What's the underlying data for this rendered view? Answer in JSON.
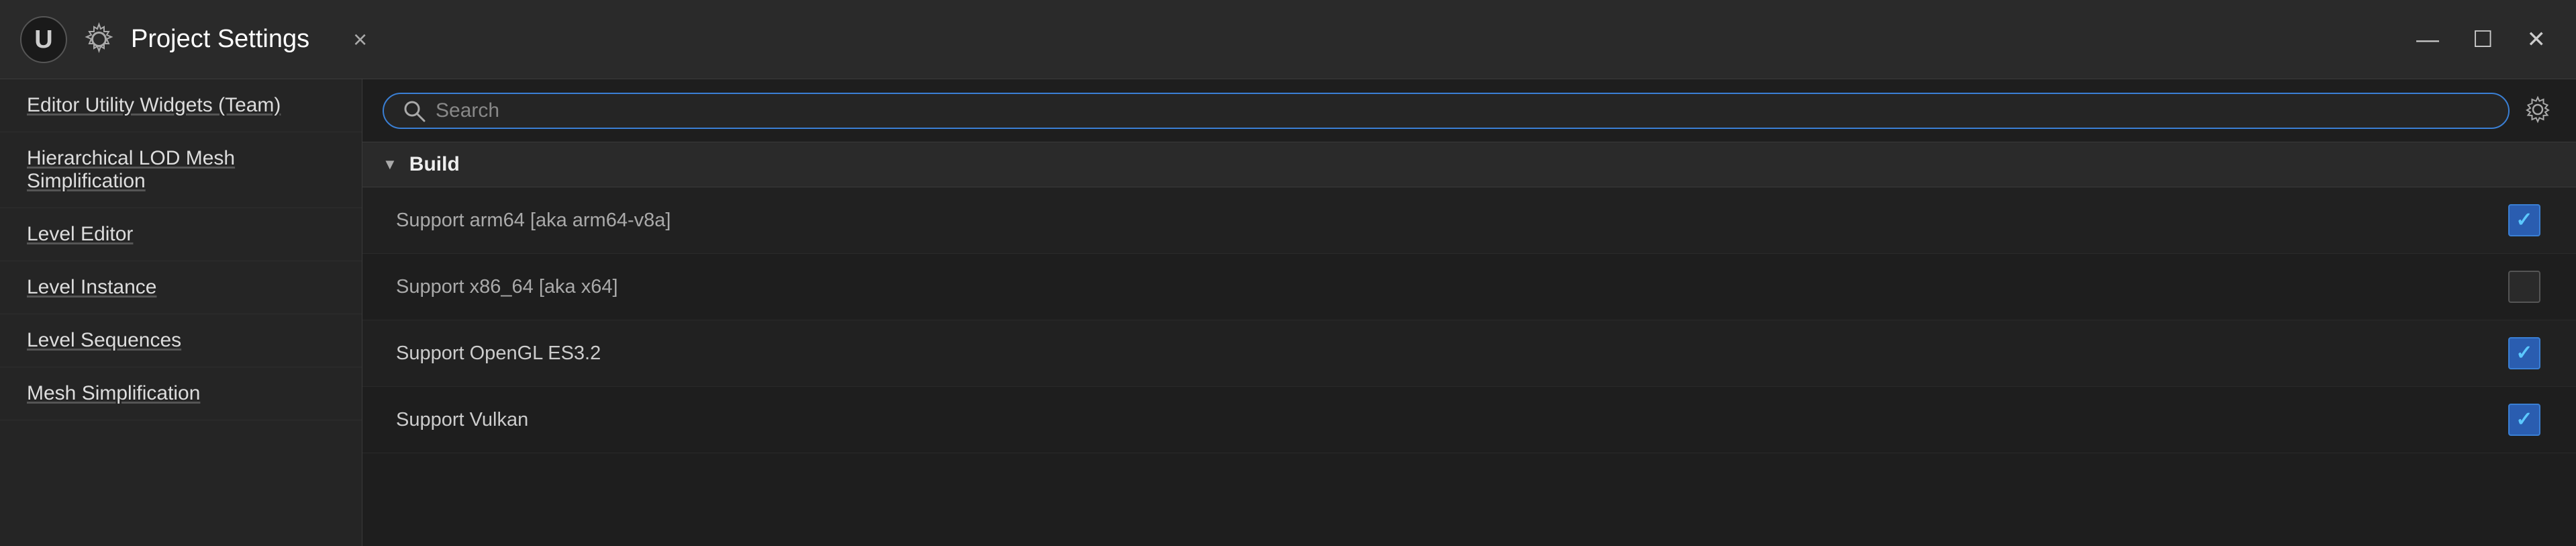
{
  "titleBar": {
    "title": "Project Settings",
    "closeTabLabel": "×"
  },
  "windowControls": {
    "minimize": "—",
    "maximize": "☐",
    "close": "✕"
  },
  "sidebar": {
    "items": [
      {
        "label": "Editor Utility Widgets (Team)"
      },
      {
        "label": "Hierarchical LOD Mesh Simplification"
      },
      {
        "label": "Level Editor"
      },
      {
        "label": "Level Instance"
      },
      {
        "label": "Level Sequences"
      },
      {
        "label": "Mesh Simplification"
      }
    ]
  },
  "searchBar": {
    "placeholder": "Search"
  },
  "section": {
    "name": "Build",
    "settings": [
      {
        "label": "Support arm64 [aka arm64-v8a]",
        "checked": true,
        "dimmed": true
      },
      {
        "label": "Support x86_64 [aka x64]",
        "checked": false,
        "dimmed": true
      },
      {
        "label": "Support OpenGL ES3.2",
        "checked": true,
        "dimmed": false
      },
      {
        "label": "Support Vulkan",
        "checked": true,
        "dimmed": false
      }
    ]
  },
  "icons": {
    "search": "🔍",
    "gear": "⚙",
    "chevronDown": "▼"
  }
}
